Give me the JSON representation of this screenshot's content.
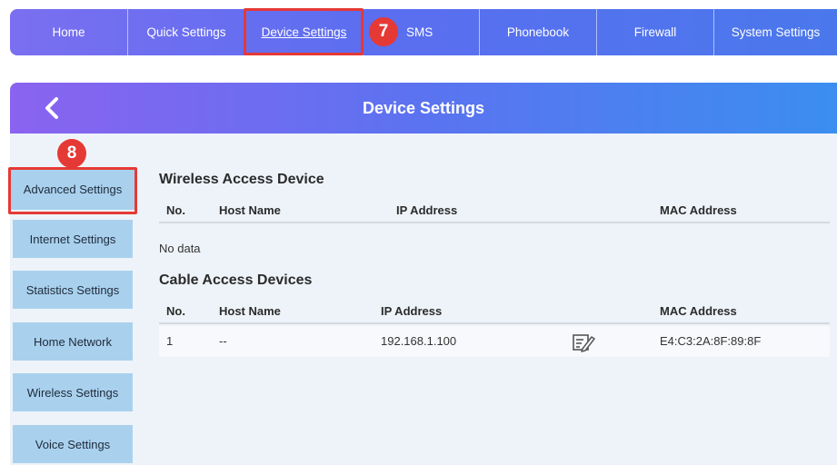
{
  "nav": {
    "items": [
      {
        "label": "Home"
      },
      {
        "label": "Quick Settings"
      },
      {
        "label": "Device Settings"
      },
      {
        "label": "SMS"
      },
      {
        "label": "Phonebook"
      },
      {
        "label": "Firewall"
      },
      {
        "label": "System Settings"
      }
    ],
    "active_index": 2
  },
  "annotations": {
    "step7": "7",
    "step8": "8",
    "color": "#e53935"
  },
  "panel": {
    "title": "Device Settings"
  },
  "sidebar": {
    "items": [
      {
        "label": "Advanced Settings"
      },
      {
        "label": "Internet Settings"
      },
      {
        "label": "Statistics Settings"
      },
      {
        "label": "Home Network"
      },
      {
        "label": "Wireless Settings"
      },
      {
        "label": "Voice Settings"
      }
    ]
  },
  "wireless": {
    "title": "Wireless Access Device",
    "columns": [
      "No.",
      "Host Name",
      "IP Address",
      "MAC Address"
    ],
    "empty_text": "No data"
  },
  "cable": {
    "title": "Cable Access Devices",
    "columns": [
      "No.",
      "Host Name",
      "IP Address",
      "MAC Address"
    ],
    "rows": [
      {
        "no": "1",
        "host": "--",
        "ip": "192.168.1.100",
        "mac": "E4:C3:2A:8F:89:8F",
        "edit_icon": "edit-icon"
      }
    ]
  },
  "colors": {
    "nav_gradient_start": "#7a6ff0",
    "nav_gradient_end": "#4a78ec",
    "sidebar_button": "#a9d1ee",
    "panel_background": "#eef3f9"
  }
}
